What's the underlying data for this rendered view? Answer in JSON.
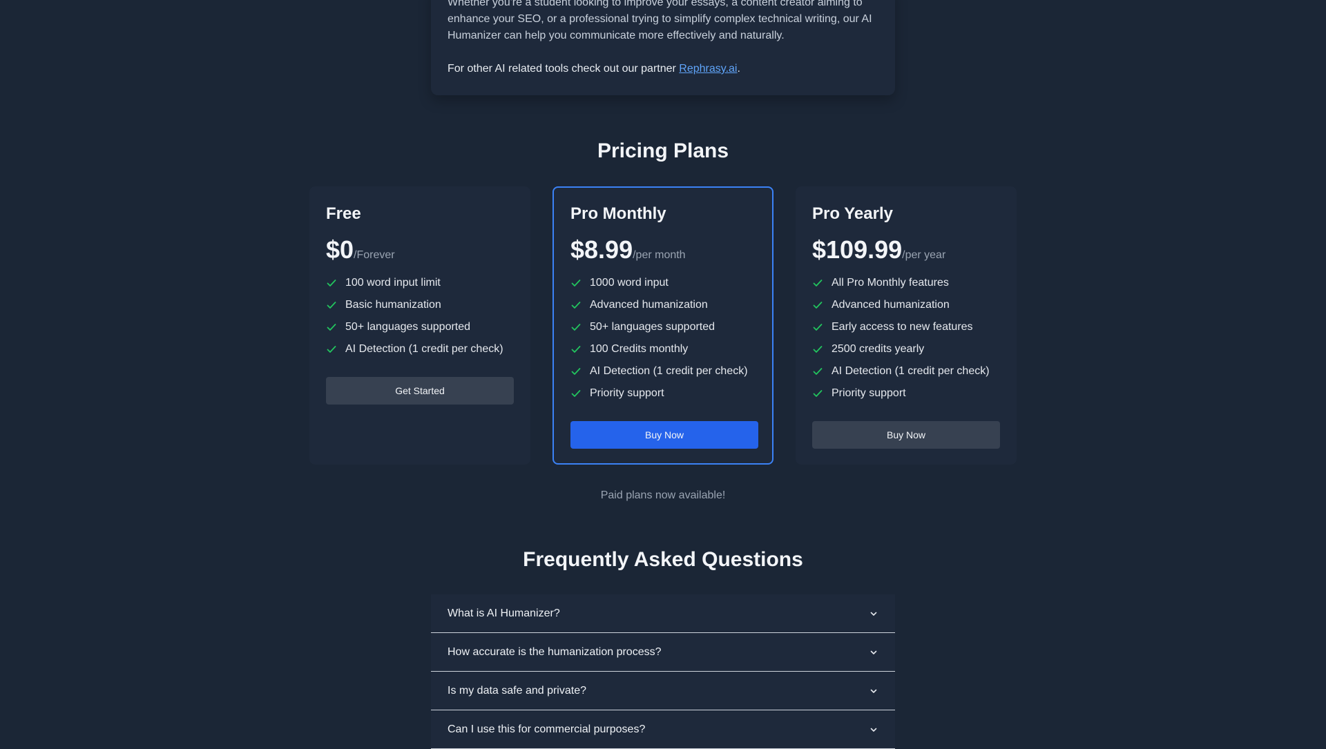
{
  "intro": {
    "paragraph": "Whether you're a student looking to improve your essays, a content creator aiming to enhance your SEO, or a professional trying to simplify complex technical writing, our AI Humanizer can help you communicate more effectively and naturally.",
    "partner_prefix": "For other AI related tools check out our partner ",
    "partner_link": "Rephrasy.ai",
    "partner_suffix": "."
  },
  "pricing": {
    "title": "Pricing Plans",
    "plans": [
      {
        "name": "Free",
        "price": "$0",
        "period": "/Forever",
        "features": [
          "100 word input limit",
          "Basic humanization",
          "50+ languages supported",
          "AI Detection (1 credit per check)"
        ],
        "button": "Get Started"
      },
      {
        "name": "Pro Monthly",
        "price": "$8.99",
        "period": "/per month",
        "features": [
          "1000 word input",
          "Advanced humanization",
          "50+ languages supported",
          "100 Credits monthly",
          "AI Detection (1 credit per check)",
          "Priority support"
        ],
        "button": "Buy Now"
      },
      {
        "name": "Pro Yearly",
        "price": "$109.99",
        "period": "/per year",
        "features": [
          "All Pro Monthly features",
          "Advanced humanization",
          "Early access to new features",
          "2500 credits yearly",
          "AI Detection (1 credit per check)",
          "Priority support"
        ],
        "button": "Buy Now"
      }
    ],
    "note": "Paid plans now available!"
  },
  "faq": {
    "title": "Frequently Asked Questions",
    "questions": [
      "What is AI Humanizer?",
      "How accurate is the humanization process?",
      "Is my data safe and private?",
      "Can I use this for commercial purposes?"
    ]
  },
  "colors": {
    "background": "#1b2636",
    "card": "#1e293b",
    "accent": "#2563eb",
    "featured_border": "#3b82f6",
    "check": "#22c55e",
    "link": "#60a5fa"
  },
  "icons": {
    "feature": "check-icon",
    "faq": "chevron-down-icon"
  }
}
